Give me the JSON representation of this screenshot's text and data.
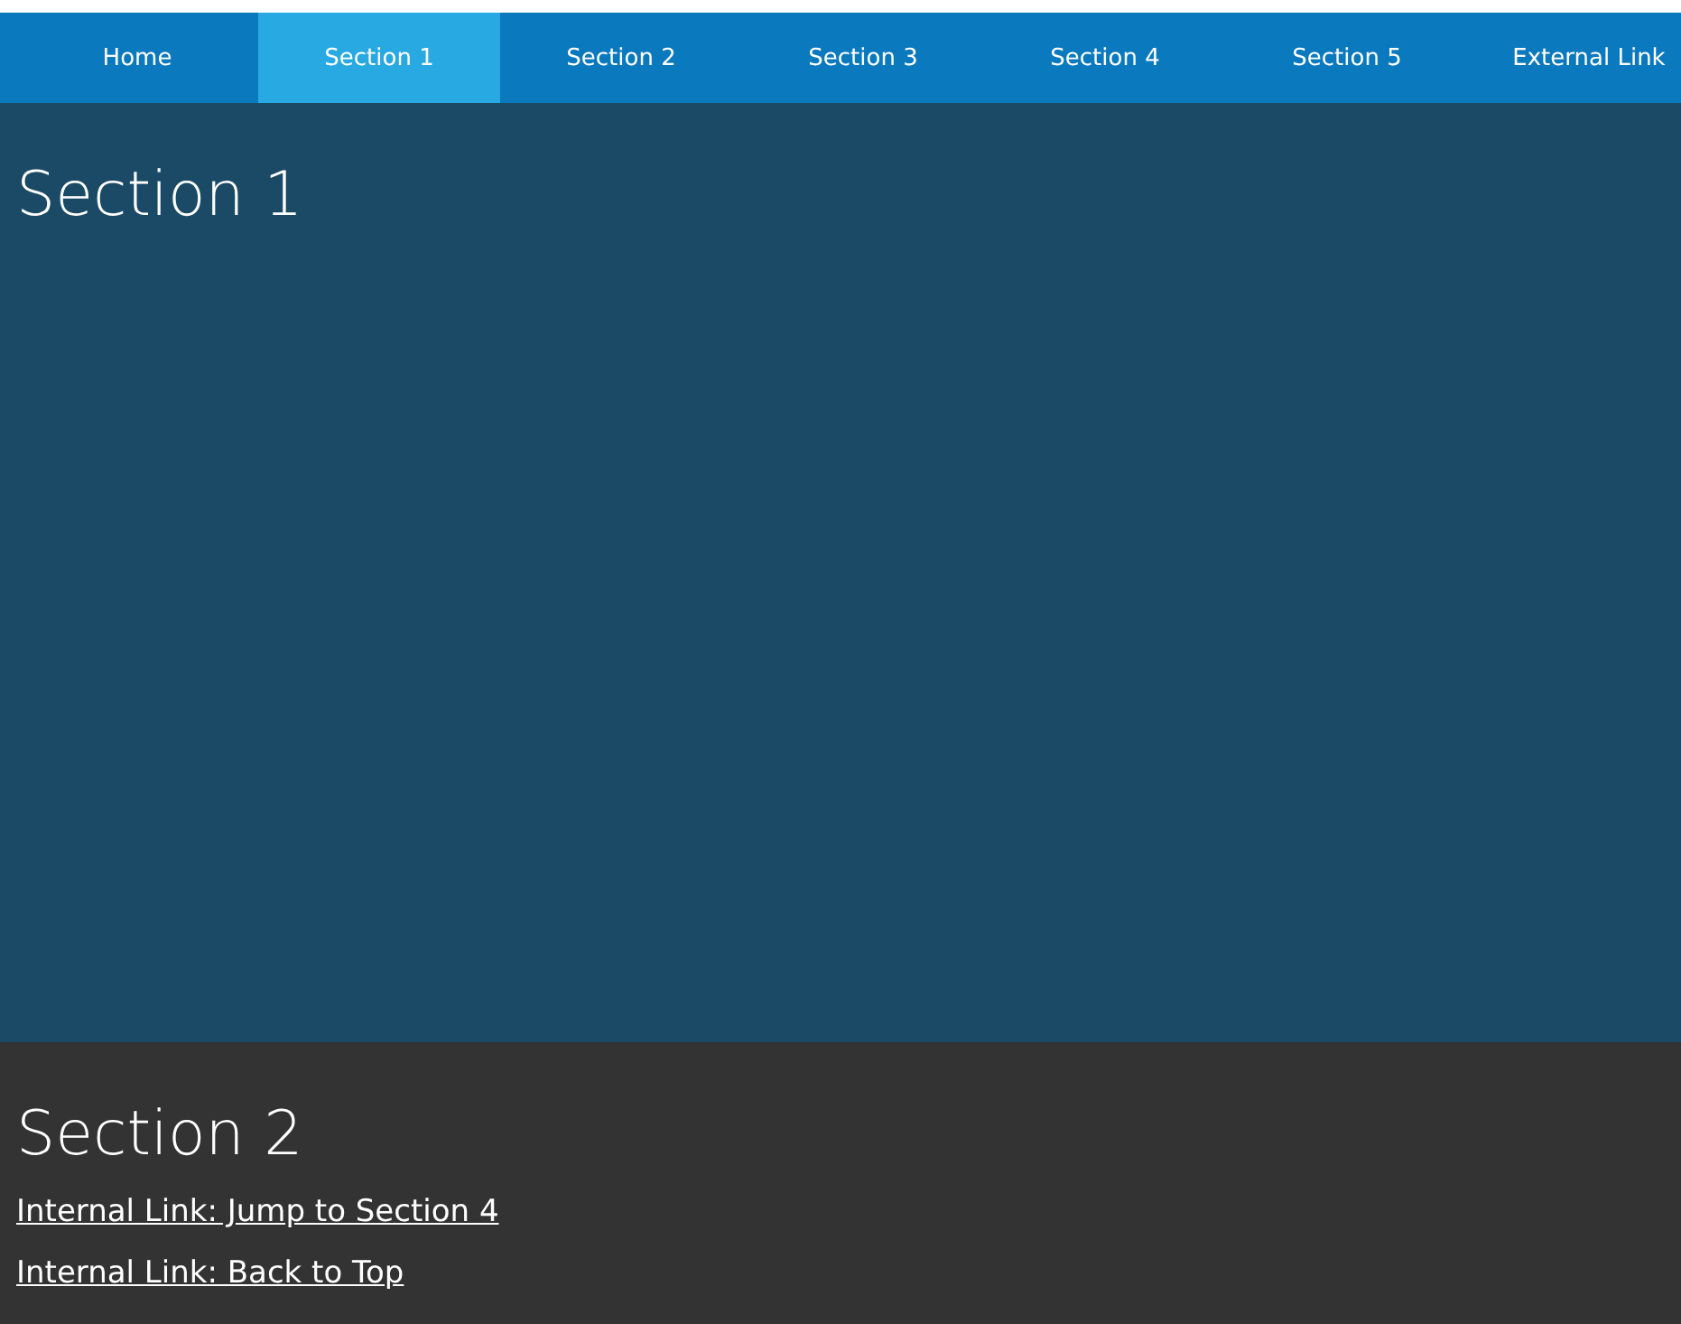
{
  "nav": [
    {
      "label": "Home",
      "selected": false
    },
    {
      "label": "Section 1",
      "selected": true
    },
    {
      "label": "Section 2",
      "selected": false
    },
    {
      "label": "Section 3",
      "selected": false
    },
    {
      "label": "Section 4",
      "selected": false
    },
    {
      "label": "Section 5",
      "selected": false
    },
    {
      "label": "External Link",
      "selected": false
    }
  ],
  "sections": [
    {
      "title": "Section 1"
    },
    {
      "title": "Section 2",
      "links": [
        "Internal Link: Jump to Section 4",
        "Internal Link: Back to Top"
      ]
    }
  ]
}
